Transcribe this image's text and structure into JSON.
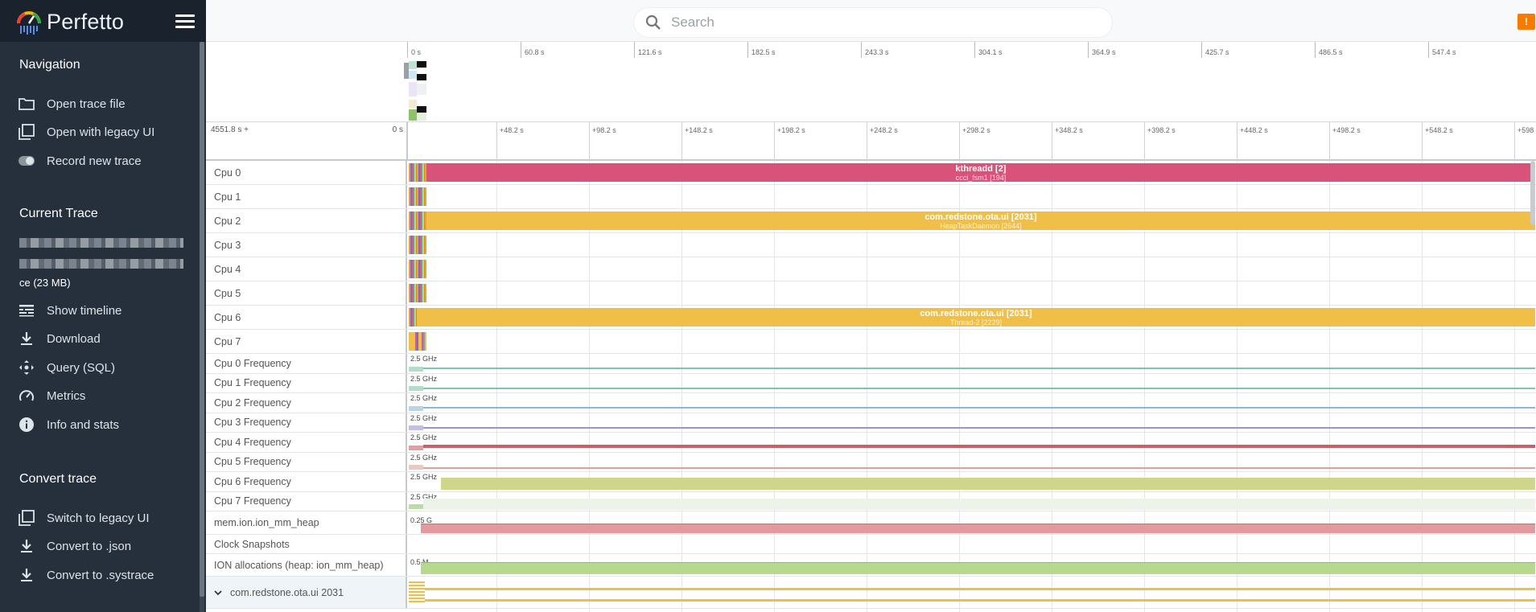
{
  "app": {
    "name": "Perfetto"
  },
  "sidebar": {
    "navigation_title": "Navigation",
    "navigation": [
      {
        "label": "Open trace file",
        "icon": "folder-icon"
      },
      {
        "label": "Open with legacy UI",
        "icon": "filter-none-icon"
      },
      {
        "label": "Record new trace",
        "icon": "toggle-icon"
      }
    ],
    "current_trace_title": "Current Trace",
    "trace_name": "ce (23 MB)",
    "current_trace": [
      {
        "label": "Show timeline",
        "icon": "timeline-icon"
      },
      {
        "label": "Download",
        "icon": "download-icon"
      },
      {
        "label": "Query (SQL)",
        "icon": "move-icon"
      },
      {
        "label": "Metrics",
        "icon": "speedometer-icon"
      },
      {
        "label": "Info and stats",
        "icon": "info-icon"
      }
    ],
    "convert_title": "Convert trace",
    "convert": [
      {
        "label": "Switch to legacy UI",
        "icon": "filter-none-icon"
      },
      {
        "label": "Convert to .json",
        "icon": "download-icon"
      },
      {
        "label": "Convert to .systrace",
        "icon": "download-icon"
      }
    ]
  },
  "topbar": {
    "search_placeholder": "Search",
    "warning": "!"
  },
  "overview": {
    "ticks": [
      "0 s",
      "60.8 s",
      "121.6 s",
      "182.5 s",
      "243.3 s",
      "304.1 s",
      "364.9 s",
      "425.7 s",
      "486.5 s",
      "547.4 s"
    ]
  },
  "timeaxis": {
    "offset": "4551.8 s +",
    "zero": "0 s",
    "ticks": [
      "+48.2 s",
      "+98.2 s",
      "+148.2 s",
      "+198.2 s",
      "+248.2 s",
      "+298.2 s",
      "+348.2 s",
      "+398.2 s",
      "+448.2 s",
      "+498.2 s",
      "+548.2 s",
      "+598"
    ]
  },
  "tracks": {
    "cpus": [
      {
        "name": "Cpu 0",
        "slice": {
          "title": "kthreadd [2]",
          "subtitle": "ccci_fsm1 [194]",
          "color": "#d9527a"
        }
      },
      {
        "name": "Cpu 1"
      },
      {
        "name": "Cpu 2",
        "slice": {
          "title": "com.redstone.ota.ui [2031]",
          "subtitle": "HeapTaskDaemon [2644]",
          "color": "#efbf48"
        }
      },
      {
        "name": "Cpu 3"
      },
      {
        "name": "Cpu 4"
      },
      {
        "name": "Cpu 5"
      },
      {
        "name": "Cpu 6",
        "slice": {
          "title": "com.redstone.ota.ui [2031]",
          "subtitle": "Thread-2 [2229]",
          "color": "#efbf48"
        }
      },
      {
        "name": "Cpu 7"
      }
    ],
    "freqs": [
      {
        "name": "Cpu 0 Frequency",
        "label": "2.5 GHz",
        "color": "#7fc6a8"
      },
      {
        "name": "Cpu 1 Frequency",
        "label": "2.5 GHz",
        "color": "#7fc6a8"
      },
      {
        "name": "Cpu 2 Frequency",
        "label": "2.5 GHz",
        "color": "#8bb7d8"
      },
      {
        "name": "Cpu 3 Frequency",
        "label": "2.5 GHz",
        "color": "#9b93d8"
      },
      {
        "name": "Cpu 4 Frequency",
        "label": "2.5 GHz",
        "color": "#c4616a"
      },
      {
        "name": "Cpu 5 Frequency",
        "label": "2.5 GHz",
        "color": "#d8a79b"
      },
      {
        "name": "Cpu 6 Frequency",
        "label": "2.5 GHz",
        "color": "#cfd68a"
      },
      {
        "name": "Cpu 7 Frequency",
        "label": "2.5 GHz",
        "color": "#c9dcb5"
      }
    ],
    "counters": [
      {
        "name": "mem.ion.ion_mm_heap",
        "label": "0.25 G",
        "color": "#e39a9e"
      },
      {
        "name": "Clock Snapshots",
        "label": ""
      },
      {
        "name": "ION allocations (heap: ion_mm_heap)",
        "label": "0.5 M",
        "color": "#b7d98e"
      }
    ],
    "group": {
      "name": "com.redstone.ota.ui 2031"
    }
  },
  "colors": {
    "sidebar_bg": "#262f3c",
    "sidebar_header_bg": "#1a222d",
    "accent_warning": "#f57c00"
  }
}
